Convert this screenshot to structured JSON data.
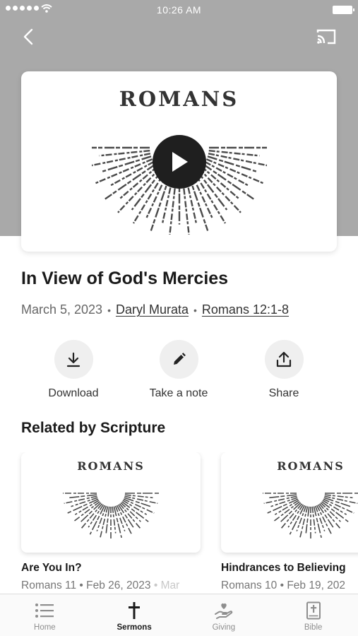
{
  "status_bar": {
    "time": "10:26 AM"
  },
  "header": {
    "back_icon": "chevron-left-icon",
    "cast_icon": "cast-icon"
  },
  "artwork": {
    "series_title": "ROMANS",
    "play_icon": "play-icon"
  },
  "sermon": {
    "title": "In View of God's Mercies",
    "date": "March 5, 2023",
    "speaker": "Daryl Murata",
    "scripture": "Romans 12:1-8"
  },
  "actions": [
    {
      "label": "Download",
      "icon": "download-icon"
    },
    {
      "label": "Take a note",
      "icon": "pencil-icon"
    },
    {
      "label": "Share",
      "icon": "share-icon"
    }
  ],
  "related": {
    "heading": "Related by Scripture",
    "items": [
      {
        "thumb_title": "ROMANS",
        "title": "Are You In?",
        "scripture": "Romans 11",
        "date": "Feb 26, 2023",
        "extra": "Mar"
      },
      {
        "thumb_title": "ROMANS",
        "title": "Hindrances to Believing",
        "scripture": "Romans 10",
        "date": "Feb 19, 202",
        "extra": ""
      }
    ]
  },
  "tab_bar": {
    "tabs": [
      {
        "label": "Home",
        "icon": "list-icon",
        "active": false
      },
      {
        "label": "Sermons",
        "icon": "cross-icon",
        "active": true
      },
      {
        "label": "Giving",
        "icon": "giving-hand-icon",
        "active": false
      },
      {
        "label": "Bible",
        "icon": "bible-icon",
        "active": false
      }
    ]
  },
  "colors": {
    "hero_background": "#a9a9a9",
    "text_primary": "#1a1a1a",
    "text_secondary": "#666666",
    "tab_inactive": "#8e8e8e"
  }
}
